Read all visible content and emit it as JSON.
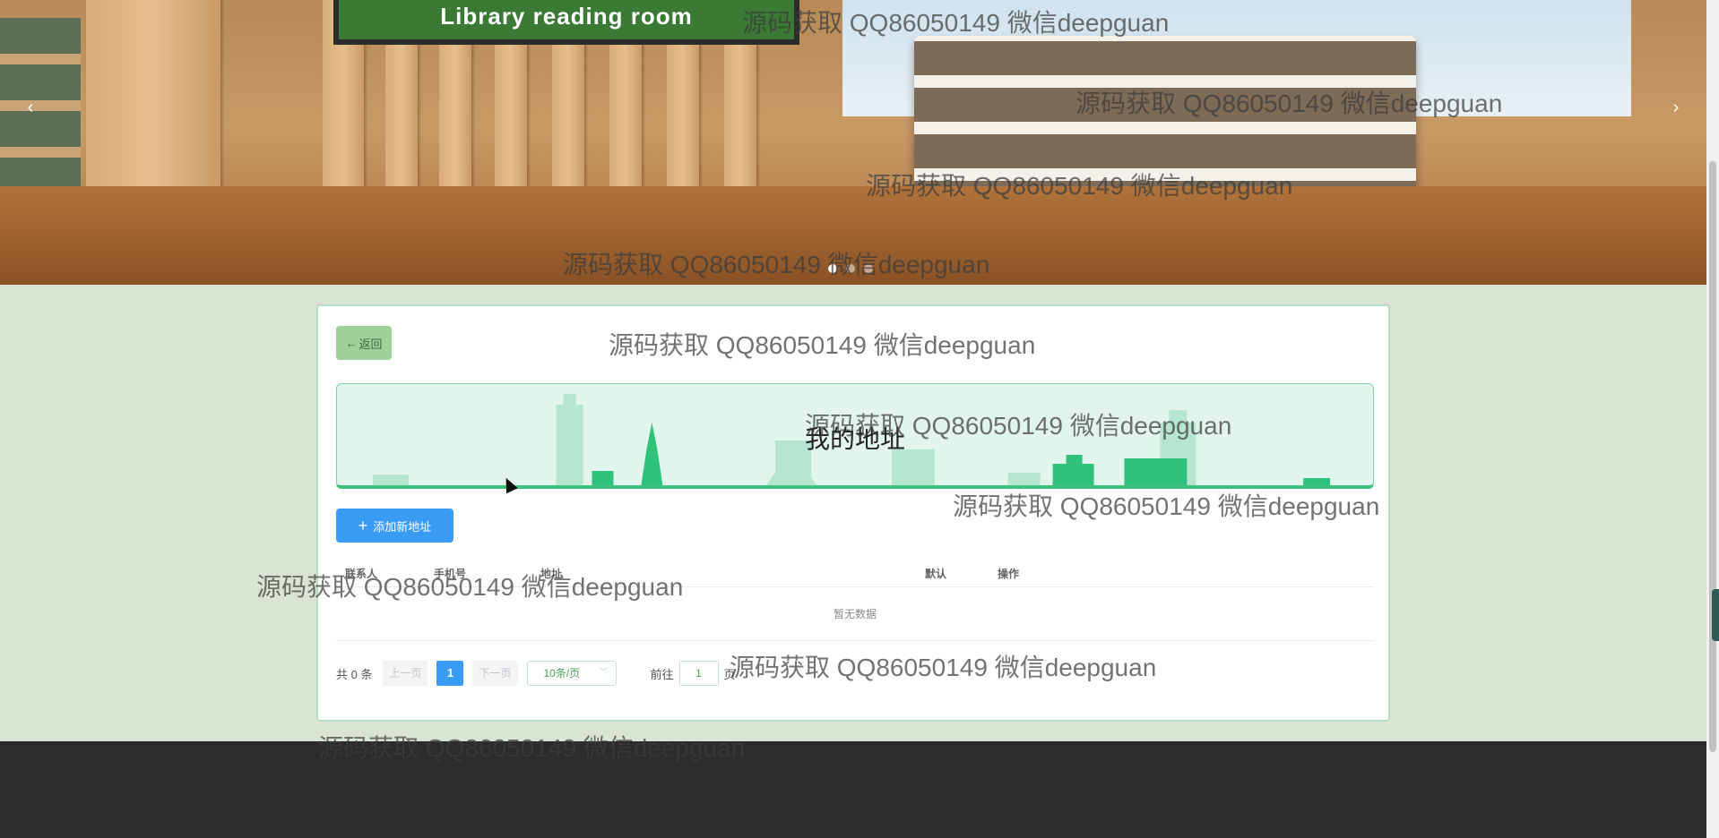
{
  "banner": {
    "sign_text": "Library reading room",
    "prev_arrow": "‹",
    "next_arrow": "›",
    "slide_count": 3,
    "active_slide": 1
  },
  "card": {
    "back_label": "返回",
    "section_title": "我的地址",
    "add_button_label": "添加新地址",
    "table": {
      "headers": [
        "联系人",
        "手机号",
        "地址",
        "默认",
        "操作"
      ],
      "empty_text": "暂无数据"
    },
    "pagination": {
      "total": "共 0 条",
      "prev": "上一页",
      "current_page": "1",
      "next": "下一页",
      "page_size": "10条/页",
      "goto_label": "前往",
      "goto_value": "1",
      "goto_suffix": "页"
    }
  },
  "watermark": "源码获取 QQ86050149 微信deepguan",
  "colors": {
    "accent_blue": "#3a9bf4",
    "back_green": "#9fd19a",
    "title_bar_bg": "#e2f5ec",
    "footer": "#2c2c2c"
  }
}
